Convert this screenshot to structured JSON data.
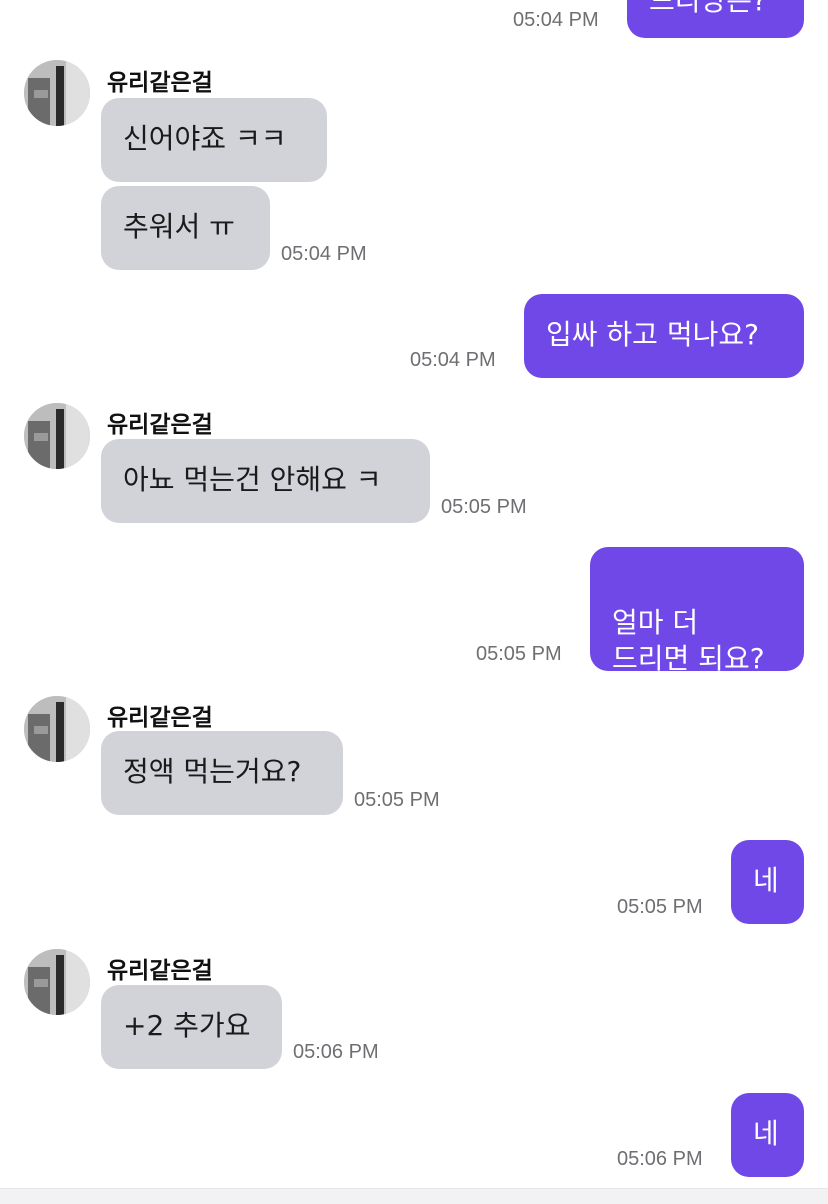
{
  "contact": {
    "name": "유리같은걸"
  },
  "messages": {
    "m0": {
      "text": "드리냥은?",
      "time": "05:04 PM"
    },
    "m1": {
      "text": "신어야죠 ㅋㅋ"
    },
    "m2": {
      "text": "추워서 ㅠ",
      "time": "05:04 PM"
    },
    "m3": {
      "text": "입싸 하고 먹나요?",
      "time": "05:04 PM"
    },
    "m4": {
      "text": "아뇨 먹는건 안해요 ㅋ",
      "time": "05:05 PM"
    },
    "m5": {
      "text": "얼마 더\n드리면 되요?",
      "time": "05:05 PM"
    },
    "m6": {
      "text": "정액 먹는거요?",
      "time": "05:05 PM"
    },
    "m7": {
      "text": "네",
      "time": "05:05 PM"
    },
    "m8": {
      "text": "+2 추가요",
      "time": "05:06 PM"
    },
    "m9": {
      "text": "네",
      "time": "05:06 PM"
    }
  },
  "colors": {
    "outgoing_bubble": "#7048e8",
    "incoming_bubble": "#d1d3d9",
    "timestamp": "#6f6f73"
  },
  "icons": {
    "avatar": "contact-avatar-photo"
  }
}
